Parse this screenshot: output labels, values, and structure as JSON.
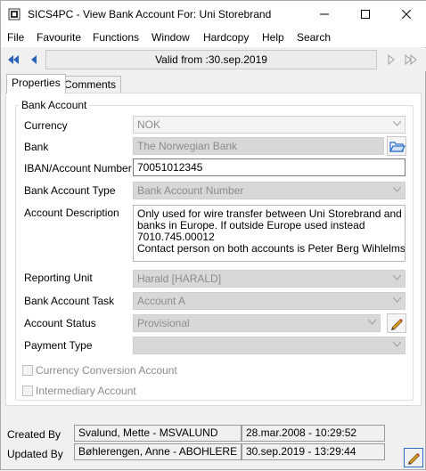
{
  "window": {
    "title": "SICS4PC - View Bank Account For: Uni Storebrand"
  },
  "menu": [
    "File",
    "Favourite",
    "Functions",
    "Window",
    "Hardcopy",
    "Help",
    "Search"
  ],
  "nav": {
    "valid_from": "Valid from :30.sep.2019"
  },
  "tabs": [
    "Properties",
    "Comments"
  ],
  "group": {
    "label": "Bank Account"
  },
  "form": {
    "currency_label": "Currency",
    "currency_value": "NOK",
    "bank_label": "Bank",
    "bank_value": "The Norwegian Bank",
    "iban_label": "IBAN/Account Number",
    "iban_value": "70051012345",
    "type_label": "Bank Account Type",
    "type_value": "Bank Account Number",
    "desc_label": "Account Description",
    "desc_lines": [
      "Only used for wire transfer between Uni Storebrand and",
      "banks in Europe. If outside Europe used instead",
      "7010.745.00012",
      "Contact person on both accounts is Peter Berg Wihlelmsen"
    ],
    "reporting_label": "Reporting Unit",
    "reporting_value": "Harald [HARALD]",
    "task_label": "Bank Account Task",
    "task_value": "Account A",
    "status_label": "Account Status",
    "status_value": "Provisional",
    "payment_label": "Payment Type",
    "payment_value": "",
    "currency_conv_label": "Currency Conversion Account",
    "intermediary_label": "Intermediary Account"
  },
  "footer": {
    "created_label": "Created By",
    "created_user": "Svalund, Mette - MSVALUND",
    "created_date": "28.mar.2008 - 10:29:52",
    "updated_label": "Updated By",
    "updated_user": "Bøhlerengen, Anne - ABOHLERE",
    "updated_date": "30.sep.2019 - 13:29:44"
  },
  "colors": {
    "folder_icon": "#2b6cc4",
    "edit_pencil": "#e0a020"
  }
}
